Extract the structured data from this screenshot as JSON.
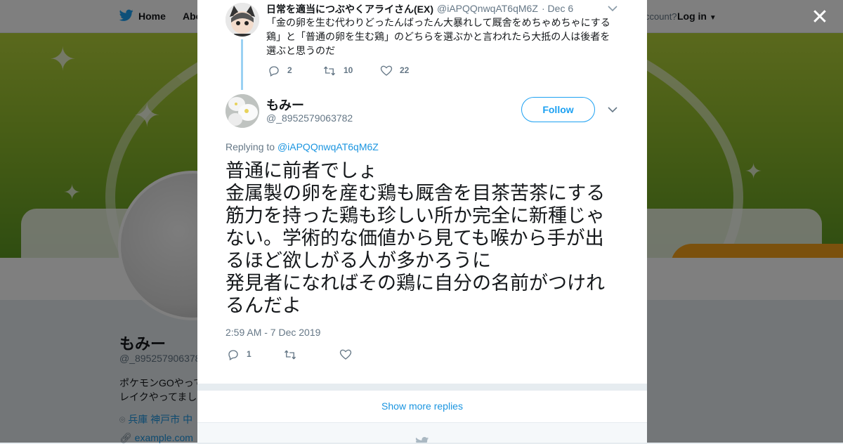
{
  "colors": {
    "accent": "#1da1f2",
    "link": "#1b95e0",
    "muted": "#657786",
    "text": "#14171a",
    "thread": "#9ad1f3"
  },
  "background": {
    "nav": {
      "home": "Home",
      "about": "Abo",
      "account_prompt": "ccount?",
      "login": "Log in"
    },
    "profile": {
      "name": "もみー",
      "handle": "@_895257906378",
      "bio_line1": "ポケモンGOやって",
      "bio_line2": "レイクやってまし",
      "location": "兵庫 神戸市 中",
      "url": "example.com"
    }
  },
  "modal": {
    "close_icon": "close-icon",
    "parent_tweet": {
      "name": "日常を適当につぶやくアライさん(EX)",
      "handle": "@iAPQQnwqAT6qM6Z",
      "time": "· Dec 6",
      "text": "「金の卵を生む代わりどったんばったん大暴れして厩舎をめちゃめちゃにする鶏」と「普通の卵を生む鶏」のどちらを選ぶかと言われたら大抵の人は後者を選ぶと思うのだ",
      "replies": "2",
      "retweets": "10",
      "likes": "22"
    },
    "main_tweet": {
      "name": "もみー",
      "handle": "@_8952579063782",
      "follow_label": "Follow",
      "replying_prefix": "Replying to",
      "replying_to": "@iAPQQnwqAT6qM6Z",
      "text": "普通に前者でしょ\n金属製の卵を産む鶏も厩舎を目茶苦茶にする筋力を持った鶏も珍しい所か完全に新種じゃない。学術的な価値から見ても喉から手が出るほど欲しがる人が多かろうに\n発見者になればその鶏に自分の名前がつけれるんだよ",
      "timestamp": "2:59 AM - 7 Dec 2019",
      "replies": "1"
    },
    "show_more": "Show more replies"
  }
}
